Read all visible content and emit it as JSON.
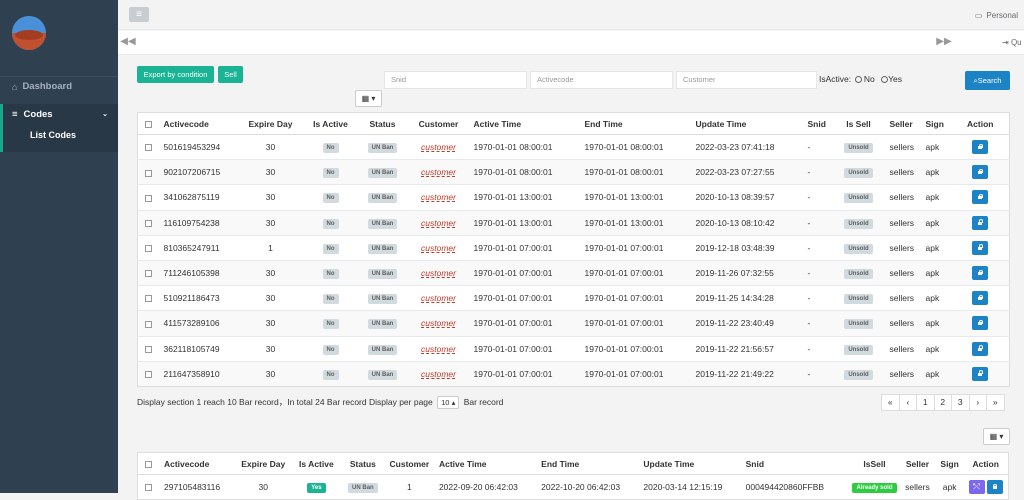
{
  "header": {
    "personal_label": "Personal",
    "quit_label": "Qu"
  },
  "sidebar": {
    "dashboard_label": "Dashboard",
    "codes_label": "Codes",
    "list_codes_label": "List Codes"
  },
  "toolbar": {
    "export_label": "Export by condition",
    "sell_label": "Sell",
    "search_label": "Search",
    "isactive_label": "IsActive:",
    "no_label": "No",
    "yes_label": "Yes"
  },
  "filters": {
    "snid_placeholder": "Snid",
    "activecode_placeholder": "Activecode",
    "customer_placeholder": "Customer"
  },
  "table1": {
    "headers": [
      "Activecode",
      "Expire Day",
      "Is Active",
      "Status",
      "Customer",
      "Active Time",
      "End Time",
      "Update Time",
      "Snid",
      "Is Sell",
      "Seller",
      "Sign",
      "Action"
    ],
    "rows": [
      {
        "code": "501619453294",
        "expire": "30",
        "active": "No",
        "status": "UN Ban",
        "customer": "customer",
        "active_time": "1970-01-01 08:00:01",
        "end_time": "1970-01-01 08:00:01",
        "update_time": "2022-03-23 07:41:18",
        "snid": "-",
        "sell": "Unsold",
        "seller": "sellers",
        "sign": "apk"
      },
      {
        "code": "902107206715",
        "expire": "30",
        "active": "No",
        "status": "UN Ban",
        "customer": "customer",
        "active_time": "1970-01-01 08:00:01",
        "end_time": "1970-01-01 08:00:01",
        "update_time": "2022-03-23 07:27:55",
        "snid": "-",
        "sell": "Unsold",
        "seller": "sellers",
        "sign": "apk"
      },
      {
        "code": "341062875119",
        "expire": "30",
        "active": "No",
        "status": "UN Ban",
        "customer": "customer",
        "active_time": "1970-01-01 13:00:01",
        "end_time": "1970-01-01 13:00:01",
        "update_time": "2020-10-13 08:39:57",
        "snid": "-",
        "sell": "Unsold",
        "seller": "sellers",
        "sign": "apk"
      },
      {
        "code": "116109754238",
        "expire": "30",
        "active": "No",
        "status": "UN Ban",
        "customer": "customer",
        "active_time": "1970-01-01 13:00:01",
        "end_time": "1970-01-01 13:00:01",
        "update_time": "2020-10-13 08:10:42",
        "snid": "-",
        "sell": "Unsold",
        "seller": "sellers",
        "sign": "apk"
      },
      {
        "code": "810365247911",
        "expire": "1",
        "active": "No",
        "status": "UN Ban",
        "customer": "customer",
        "active_time": "1970-01-01 07:00:01",
        "end_time": "1970-01-01 07:00:01",
        "update_time": "2019-12-18 03:48:39",
        "snid": "-",
        "sell": "Unsold",
        "seller": "sellers",
        "sign": "apk"
      },
      {
        "code": "711246105398",
        "expire": "30",
        "active": "No",
        "status": "UN Ban",
        "customer": "customer",
        "active_time": "1970-01-01 07:00:01",
        "end_time": "1970-01-01 07:00:01",
        "update_time": "2019-11-26 07:32:55",
        "snid": "-",
        "sell": "Unsold",
        "seller": "sellers",
        "sign": "apk"
      },
      {
        "code": "510921186473",
        "expire": "30",
        "active": "No",
        "status": "UN Ban",
        "customer": "customer",
        "active_time": "1970-01-01 07:00:01",
        "end_time": "1970-01-01 07:00:01",
        "update_time": "2019-11-25 14:34:28",
        "snid": "-",
        "sell": "Unsold",
        "seller": "sellers",
        "sign": "apk"
      },
      {
        "code": "411573289106",
        "expire": "30",
        "active": "No",
        "status": "UN Ban",
        "customer": "customer",
        "active_time": "1970-01-01 07:00:01",
        "end_time": "1970-01-01 07:00:01",
        "update_time": "2019-11-22 23:40:49",
        "snid": "-",
        "sell": "Unsold",
        "seller": "sellers",
        "sign": "apk"
      },
      {
        "code": "362118105749",
        "expire": "30",
        "active": "No",
        "status": "UN Ban",
        "customer": "customer",
        "active_time": "1970-01-01 07:00:01",
        "end_time": "1970-01-01 07:00:01",
        "update_time": "2019-11-22 21:56:57",
        "snid": "-",
        "sell": "Unsold",
        "seller": "sellers",
        "sign": "apk"
      },
      {
        "code": "211647358910",
        "expire": "30",
        "active": "No",
        "status": "UN Ban",
        "customer": "customer",
        "active_time": "1970-01-01 07:00:01",
        "end_time": "1970-01-01 07:00:01",
        "update_time": "2019-11-22 21:49:22",
        "snid": "-",
        "sell": "Unsold",
        "seller": "sellers",
        "sign": "apk"
      }
    ]
  },
  "pagination": {
    "info_prefix": "Display section 1 reach 10 Bar record，In total 24 Bar record Display per page",
    "per_page": "10",
    "info_suffix": "Bar record",
    "pages": [
      "«",
      "‹",
      "1",
      "2",
      "3",
      "›",
      "»"
    ]
  },
  "table2": {
    "headers": [
      "Activecode",
      "Expire Day",
      "Is Active",
      "Status",
      "Customer",
      "Active Time",
      "End Time",
      "Update Time",
      "Snid",
      "IsSell",
      "Seller",
      "Sign",
      "Action"
    ],
    "rows": [
      {
        "code": "297105483116",
        "expire": "30",
        "active": "Yes",
        "status": "UN Ban",
        "customer": "1",
        "active_time": "2022-09-20 06:42:03",
        "end_time": "2022-10-20 06:42:03",
        "update_time": "2020-03-14 12:15:19",
        "snid": "000494420860FFBB",
        "sell": "Already sold",
        "seller": "sellers",
        "sign": "apk"
      }
    ]
  },
  "colors": {
    "sidebar": "#2f4050",
    "accent": "#1ab394",
    "primary": "#1c84c6"
  }
}
